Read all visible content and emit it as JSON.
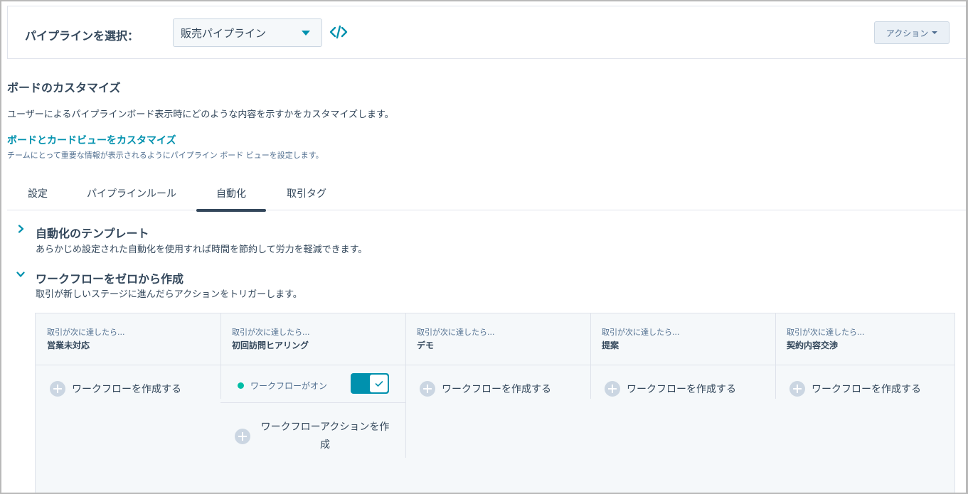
{
  "header": {
    "pipeline_label": "パイプラインを選択：",
    "pipeline_selected": "販売パイプライン",
    "actions_label": "アクション"
  },
  "board": {
    "title": "ボードのカスタマイズ",
    "description": "ユーザーによるパイプラインボード表示時にどのような内容を示すかをカスタマイズします。",
    "link_label": "ボードとカードビューをカスタマイズ",
    "link_description": "チームにとって重要な情報が表示されるようにパイプライン ボード ビューを設定します。"
  },
  "tabs": [
    {
      "label": "設定"
    },
    {
      "label": "パイプラインルール"
    },
    {
      "label": "自動化",
      "active": true
    },
    {
      "label": "取引タグ"
    }
  ],
  "templates": {
    "title": "自動化のテンプレート",
    "description": "あらかじめ設定された自動化を使用すれば時間を節約して労力を軽減できます。",
    "expanded": false
  },
  "scratch": {
    "title": "ワークフローをゼロから作成",
    "description": "取引が新しいステージに進んだらアクションをトリガーします。",
    "expanded": true
  },
  "stages": [
    {
      "prefix": "取引が次に達したら...",
      "name": "営業未対応",
      "create_label": "ワークフローを作成する"
    },
    {
      "prefix": "取引が次に達したら...",
      "name": "初回訪問ヒアリング",
      "workflow_status": "ワークフローがオン",
      "workflow_on": true,
      "action_label": "ワークフローアクションを作成"
    },
    {
      "prefix": "取引が次に達したら...",
      "name": "デモ",
      "create_label": "ワークフローを作成する"
    },
    {
      "prefix": "取引が次に達したら...",
      "name": "提案",
      "create_label": "ワークフローを作成する"
    },
    {
      "prefix": "取引が次に達したら...",
      "name": "契約内容交渉",
      "create_label": "ワークフローを作成する"
    }
  ],
  "colors": {
    "accent": "#0091ae",
    "text": "#33475b",
    "status_on": "#00bda5"
  },
  "icons": {
    "code": "code-embed-icon",
    "caret": "caret-down-icon",
    "plus": "plus-circle-icon",
    "check": "check-icon",
    "chevron_right": "chevron-right-icon",
    "chevron_down": "chevron-down-icon"
  }
}
